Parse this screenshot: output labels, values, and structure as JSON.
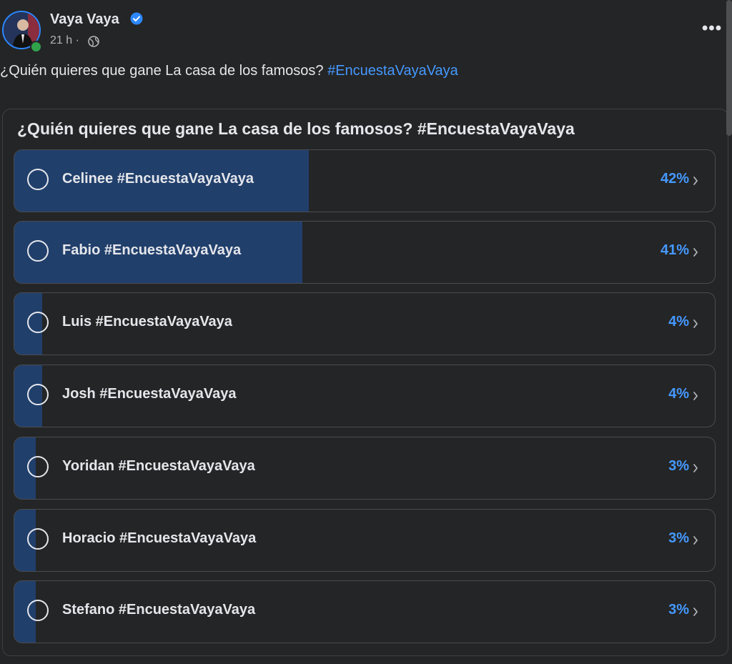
{
  "post": {
    "author": "Vaya Vaya",
    "time": "21 h ·",
    "text_main": "¿Quién quieres que gane La casa de los famosos? ",
    "text_hashtag": "#EncuestaVayaVaya"
  },
  "poll": {
    "title": "¿Quién quieres que gane La casa de los famosos? #EncuestaVayaVaya",
    "options": [
      {
        "label": "Celinee #EncuestaVayaVaya",
        "percent_text": "42%",
        "percent": 42
      },
      {
        "label": "Fabio #EncuestaVayaVaya",
        "percent_text": "41%",
        "percent": 41
      },
      {
        "label": "Luis #EncuestaVayaVaya",
        "percent_text": "4%",
        "percent": 4
      },
      {
        "label": "Josh #EncuestaVayaVaya",
        "percent_text": "4%",
        "percent": 4
      },
      {
        "label": "Yoridan #EncuestaVayaVaya",
        "percent_text": "3%",
        "percent": 3
      },
      {
        "label": "Horacio #EncuestaVayaVaya",
        "percent_text": "3%",
        "percent": 3
      },
      {
        "label": "Stefano #EncuestaVayaVaya",
        "percent_text": "3%",
        "percent": 3
      }
    ]
  },
  "icons": {
    "verified": "verified-badge-icon",
    "audience": "globe-icon",
    "more": "more-options-icon",
    "option_chevron": "chevron-right-icon"
  },
  "colors": {
    "background": "#242526",
    "accent": "#4599ff",
    "bar_fill": "#213f6b",
    "online": "#31a24c"
  }
}
